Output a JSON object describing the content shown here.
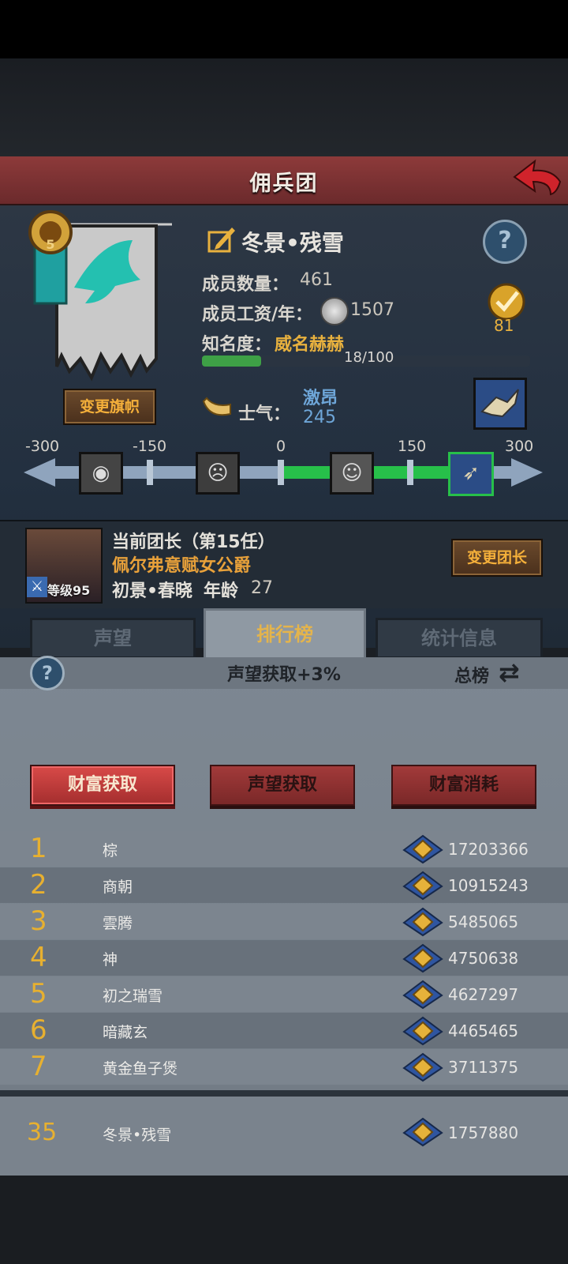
{
  "header": {
    "title": "佣兵团"
  },
  "guild": {
    "name": "冬景•残雪",
    "level_badge": "5",
    "members_label": "成员数量：",
    "members_value": "461",
    "salary_label": "成员工资/年：",
    "salary_value": "1507",
    "fame_label": "知名度：",
    "fame_value": "威名赫赫",
    "fame_progress": "18/100",
    "fame_fraction": 0.18,
    "rank_score": "81",
    "change_banner_label": "变更旗帜",
    "morale_label": "士气：",
    "morale_state": "激昂",
    "morale_value": "245",
    "morale_scale": [
      "-300",
      "-150",
      "0",
      "150",
      "300"
    ]
  },
  "leader": {
    "title": "当前团长（第15任）",
    "name": "佩尔弗意赋女公爵",
    "level_label": "等级95",
    "faction": "初景•春晓",
    "age_label": "年龄",
    "age_value": "27",
    "change_button": "变更团长"
  },
  "tabs": [
    "声望",
    "排行榜",
    "统计信息"
  ],
  "ranking": {
    "bonus_text": "声望获取+3%",
    "scope_label": "总榜",
    "filters": [
      "财富获取",
      "声望获取",
      "财富消耗"
    ],
    "rows": [
      {
        "rank": "1",
        "name": "棕",
        "score": "17203366"
      },
      {
        "rank": "2",
        "name": "商朝",
        "score": "10915243"
      },
      {
        "rank": "3",
        "name": "雲腾",
        "score": "5485065"
      },
      {
        "rank": "4",
        "name": "神",
        "score": "4750638"
      },
      {
        "rank": "5",
        "name": "初之瑞雪",
        "score": "4627297"
      },
      {
        "rank": "6",
        "name": "暗藏玄",
        "score": "4465465"
      },
      {
        "rank": "7",
        "name": "黄金鱼子煲",
        "score": "3711375"
      }
    ],
    "self": {
      "rank": "35",
      "name": "冬景•残雪",
      "score": "1757880"
    }
  },
  "colors": {
    "accent_gold": "#e8b13e",
    "title_red": "#8d3a3a",
    "morale_green": "#27c04a"
  }
}
